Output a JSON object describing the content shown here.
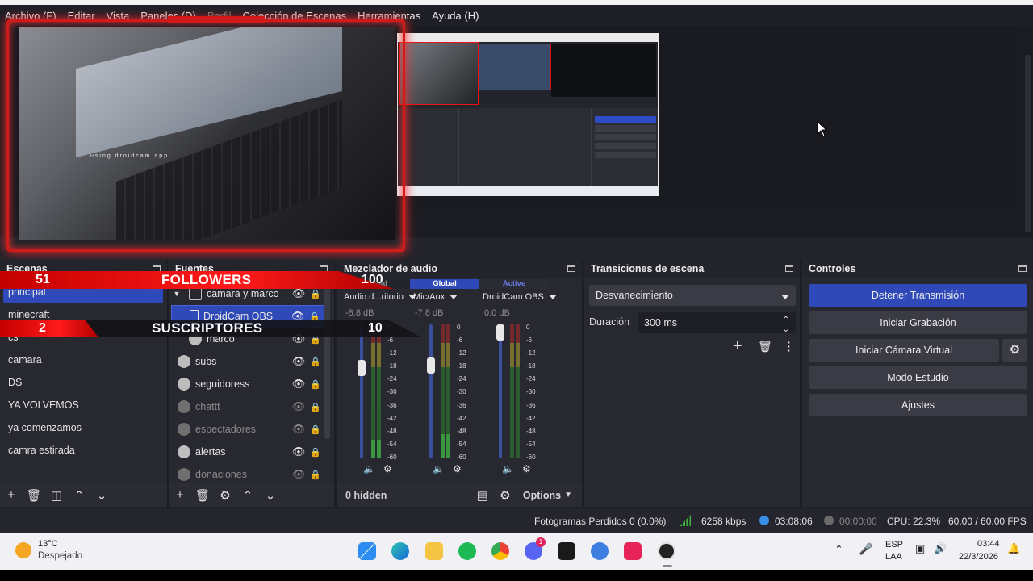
{
  "menu": {
    "items": [
      {
        "label": "Archivo (F)",
        "dim": false
      },
      {
        "label": "Editar",
        "dim": false
      },
      {
        "label": "Vista",
        "dim": false
      },
      {
        "label": "Paneles (D)",
        "dim": false
      },
      {
        "label": "Perfil",
        "dim": true
      },
      {
        "label": "Colección de Escenas",
        "dim": false
      },
      {
        "label": "Herramientas",
        "dim": false
      },
      {
        "label": "Ayuda (H)",
        "dim": false
      }
    ]
  },
  "preview": {
    "watermark": "using droidcam app"
  },
  "overlay": {
    "followers": {
      "count": "51",
      "label": "FOLLOWERS",
      "goal": "100"
    },
    "subs": {
      "count": "2",
      "label": "SUSCRIPTORES",
      "goal": "10"
    }
  },
  "scenes": {
    "title": "Escenas",
    "items": [
      "principal",
      "minecraft",
      "cs",
      "camara",
      "DS",
      "YA VOLVEMOS",
      "ya comenzamos",
      "camra estirada"
    ],
    "selected": 0
  },
  "sources": {
    "title": "Fuentes",
    "items": [
      {
        "name": "camara y marco",
        "type": "folder",
        "visible": true,
        "dim": false
      },
      {
        "name": "DroidCam OBS",
        "type": "file",
        "visible": true,
        "dim": false,
        "selected": true
      },
      {
        "name": "marco",
        "type": "image",
        "visible": true,
        "dim": false
      },
      {
        "name": "subs",
        "type": "browser",
        "visible": true,
        "dim": false
      },
      {
        "name": "seguidoress",
        "type": "browser",
        "visible": true,
        "dim": false
      },
      {
        "name": "chattt",
        "type": "browser",
        "visible": false,
        "dim": true
      },
      {
        "name": "espectadores",
        "type": "browser",
        "visible": false,
        "dim": true
      },
      {
        "name": "alertas",
        "type": "browser",
        "visible": true,
        "dim": false
      },
      {
        "name": "donaciones",
        "type": "browser",
        "visible": false,
        "dim": true
      }
    ]
  },
  "mixer": {
    "title": "Mezclador de audio",
    "channels": [
      {
        "tab": "Global",
        "name": "Audio d...ritorio",
        "db": "-8.8 dB",
        "fader": 0.7,
        "level": 0.14
      },
      {
        "tab": "Global",
        "name": "Mic/Aux",
        "db": "-7.8 dB",
        "fader": 0.72,
        "level": 0.18
      },
      {
        "tab": "Active",
        "name": "DroidCam OBS",
        "db": "0.0 dB",
        "fader": 1.0,
        "level": 0.0
      }
    ],
    "scale": [
      "0",
      "-6",
      "-12",
      "-18",
      "-24",
      "-30",
      "-36",
      "-42",
      "-48",
      "-54",
      "-60"
    ],
    "hidden": "0 hidden",
    "options": "Options"
  },
  "transitions": {
    "title": "Transiciones de escena",
    "selected": "Desvanecimiento",
    "duration_label": "Duración",
    "duration_value": "300 ms"
  },
  "controls": {
    "title": "Controles",
    "buttons": [
      "Detener Transmisión",
      "Iniciar Grabación",
      "Iniciar Cámara Virtual",
      "Modo Estudio",
      "Ajustes"
    ]
  },
  "status": {
    "dropped": "Fotogramas Perdidos 0 (0.0%)",
    "bitrate": "6258 kbps",
    "stream_time": "03:08:06",
    "rec_time": "00:00:00",
    "cpu": "CPU: 22.3%",
    "fps": "60.00 / 60.00 FPS"
  },
  "taskbar": {
    "weather_temp": "13°C",
    "weather_desc": "Despejado",
    "lang_top": "ESP",
    "lang_bottom": "LAA",
    "time": "03:44",
    "date": "22/3/2026",
    "badge": "1"
  },
  "colors": {
    "accent": "#2f4ab8",
    "overlay_red": "#e01010",
    "panel": "#272830"
  }
}
